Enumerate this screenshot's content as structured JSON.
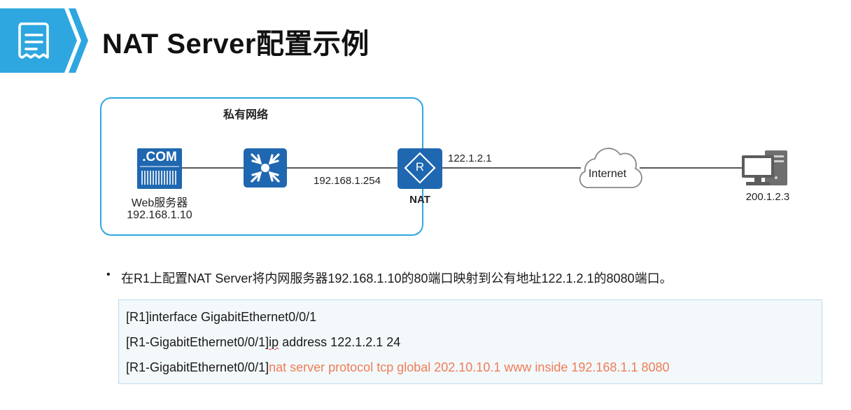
{
  "header": {
    "title": "NAT Server配置示例"
  },
  "diagram": {
    "private_network_label": "私有网络",
    "web_server": {
      "badge": ".COM",
      "label": "Web服务器",
      "ip": "192.168.1.10"
    },
    "switch": {},
    "nat_router": {
      "glyph": "R",
      "label": "NAT",
      "inside_ip": "192.168.1.254",
      "outside_ip": "122.1.2.1"
    },
    "internet": {
      "label": "Internet"
    },
    "client_pc": {
      "ip": "200.1.2.3"
    },
    "colors": {
      "accent": "#2ea7e0",
      "device_blue": "#1f67b0",
      "highlight": "#ef7d57"
    }
  },
  "bullet": {
    "dot": "•",
    "text": "在R1上配置NAT Server将内网服务器192.168.1.10的80端口映射到公有地址122.1.2.1的8080端口。"
  },
  "code": {
    "line1": "[R1]interface GigabitEthernet0/0/1",
    "line2_prefix": "[R1-GigabitEthernet0/0/1]",
    "line2_ip": "ip",
    "line2_rest": " address 122.1.2.1 24",
    "line3_prefix": "[R1-GigabitEthernet0/0/1]",
    "line3_cmd": "nat server protocol tcp global 202.10.10.1 www inside 192.168.1.1 8080"
  }
}
